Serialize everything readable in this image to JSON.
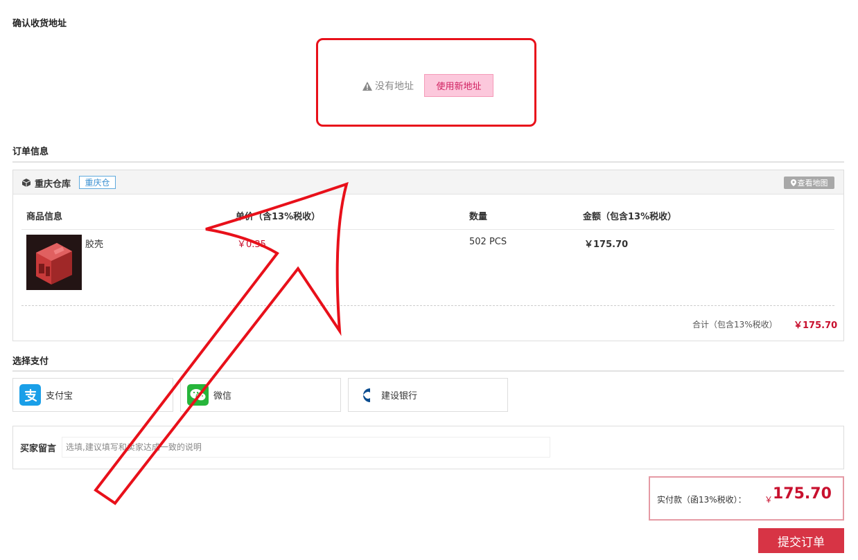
{
  "address": {
    "title": "确认收货地址",
    "empty_text": "没有地址",
    "new_button": "使用新地址"
  },
  "order": {
    "title": "订单信息",
    "warehouse_name": "重庆仓库",
    "warehouse_tag": "重庆仓",
    "map_button": "查看地图",
    "columns": {
      "product": "商品信息",
      "unit_price": "单价（含13%税收）",
      "quantity": "数量",
      "amount": "金额（包含13%税收）"
    },
    "item": {
      "name": "胶壳",
      "price": "￥0.35",
      "quantity": "502 PCS",
      "amount": "￥175.70"
    },
    "total_label": "合计（包含13%税收）",
    "total_value": "￥175.70"
  },
  "payment": {
    "title": "选择支付",
    "methods": [
      {
        "label": "支付宝",
        "icon": "alipay-icon",
        "color": "#1a9fe8"
      },
      {
        "label": "微信",
        "icon": "wechat-icon",
        "color": "#27b53b"
      },
      {
        "label": "建设银行",
        "icon": "ccb-icon",
        "color": "#0a4c8f"
      }
    ]
  },
  "note": {
    "label": "买家留言",
    "placeholder": "选填,建议填写和卖家达成一致的说明"
  },
  "summary": {
    "label": "实付款（函13%税收）：",
    "currency": "￥",
    "value": "175.70",
    "submit": "提交订单"
  }
}
